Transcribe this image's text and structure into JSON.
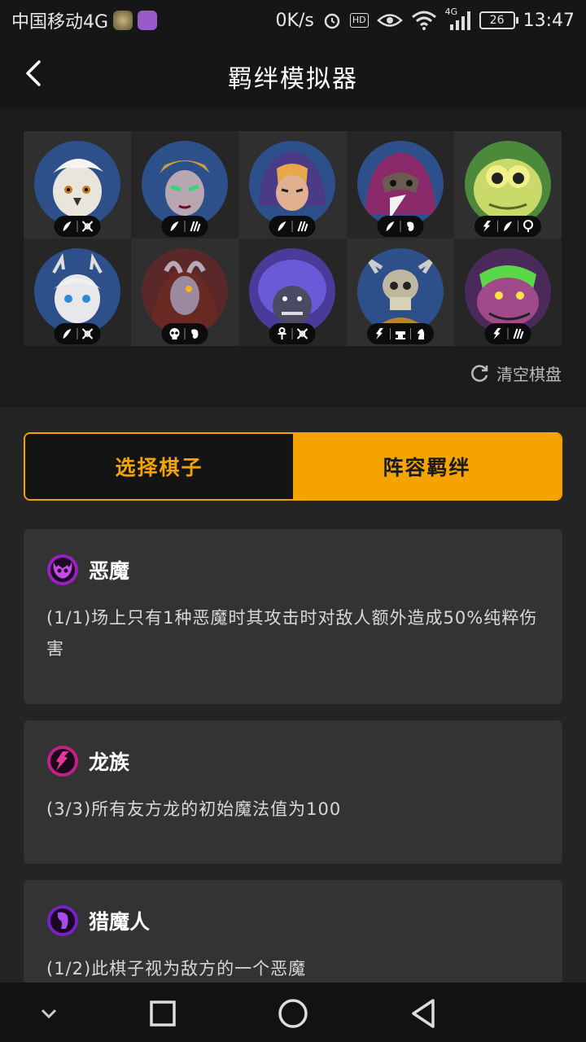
{
  "status_bar": {
    "carrier": "中国移动4G",
    "net_speed": "0K/s",
    "hd_label": "HD",
    "signal_label": "4G",
    "battery": "26",
    "time": "13:47"
  },
  "header": {
    "title": "羁绊模拟器",
    "back_icon": "chevron-left-icon"
  },
  "board": {
    "pieces": [
      {
        "name": "white-bird-warrior",
        "bg": "#2d4f8a",
        "tags": [
          "feather",
          "crossed-bows"
        ]
      },
      {
        "name": "green-witch",
        "bg": "#2d4f8a",
        "tags": [
          "feather",
          "claws"
        ]
      },
      {
        "name": "hooded-archer",
        "bg": "#2d4f8a",
        "tags": [
          "feather",
          "claws"
        ]
      },
      {
        "name": "plague-doctor",
        "bg": "#2d4f8a",
        "tags": [
          "feather",
          "mask"
        ]
      },
      {
        "name": "frog-mage",
        "bg": "#4a8a3a",
        "tags": [
          "dragon",
          "feather",
          "question"
        ]
      },
      {
        "name": "antler-girl",
        "bg": "#2d4f8a",
        "tags": [
          "feather",
          "crossed-bows"
        ]
      },
      {
        "name": "horned-demon",
        "bg": "#5a2828",
        "tags": [
          "skull",
          "mask"
        ]
      },
      {
        "name": "purple-troll",
        "bg": "#4a3a9a",
        "tags": [
          "ankh",
          "crossed-bows"
        ]
      },
      {
        "name": "skeleton-king",
        "bg": "#2d4f8a",
        "tags": [
          "dragon",
          "anvil",
          "knight"
        ]
      },
      {
        "name": "purple-dragon",
        "bg": "#4a2a5a",
        "tags": [
          "dragon",
          "claws"
        ]
      }
    ],
    "clear_label": "清空棋盘",
    "clear_icon": "refresh-icon"
  },
  "tabs": {
    "select_label": "选择棋子",
    "bonds_label": "阵容羁绊",
    "active": "bonds"
  },
  "synergies": [
    {
      "name": "恶魔",
      "icon": "demon-icon",
      "color": "#9b1fc4",
      "description": "(1/1)场上只有1种恶魔时其攻击时对敌人额外造成50%纯粹伤害"
    },
    {
      "name": "龙族",
      "icon": "dragon-icon",
      "color": "#c21f8a",
      "description": "(3/3)所有友方龙的初始魔法值为100"
    },
    {
      "name": "猎魔人",
      "icon": "demon-hunter-icon",
      "color": "#7a1fc4",
      "description": "(1/2)此棋子视为敌方的一个恶魔"
    }
  ],
  "nav": {
    "collapse_icon": "chevron-down-icon",
    "recents_icon": "square-icon",
    "home_icon": "circle-icon",
    "back_icon": "triangle-back-icon"
  }
}
